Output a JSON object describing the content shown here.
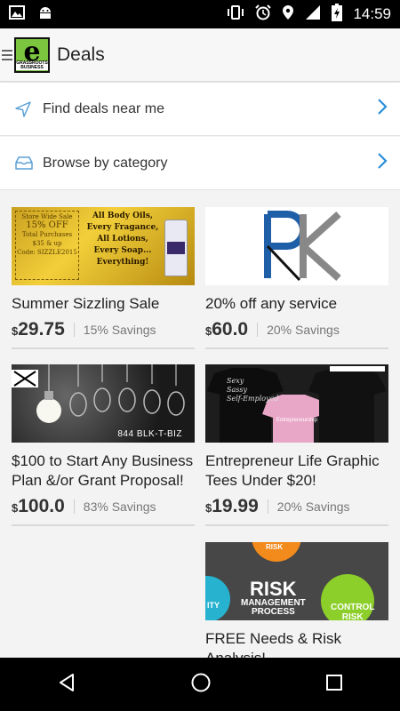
{
  "status": {
    "time": "14:59"
  },
  "header": {
    "title": "Deals",
    "logo_letter": "e",
    "logo_sub": "GRASSROOTS BUSINESS"
  },
  "rows": [
    {
      "label": "Find deals near me"
    },
    {
      "label": "Browse by category"
    }
  ],
  "deals": [
    {
      "title": "Summer Sizzling Sale",
      "currency": "$",
      "price": "29.75",
      "savings": "15% Savings",
      "image_text": [
        "All Body Oils,",
        "Every Fragance,",
        "All Lotions,",
        "Every Soap...",
        "Everything!"
      ],
      "image_coupon": [
        "Store Wide Sale",
        "15% OFF",
        "Total Purchases",
        "$35 & up",
        "Code: SIZZLE2015"
      ]
    },
    {
      "title": "20% off any service",
      "currency": "$",
      "price": "60.0",
      "savings": "20% Savings"
    },
    {
      "title": "$100 to Start Any Business Plan &/or Grant Proposal!",
      "currency": "$",
      "price": "100.0",
      "savings": "83% Savings",
      "image_text": [
        "844 BLK-T-BIZ"
      ]
    },
    {
      "title": "Entrepreneur Life Graphic Tees Under $20!",
      "currency": "$",
      "price": "19.99",
      "savings": "20% Savings",
      "image_text": [
        "Sexy",
        "Sassy",
        "Self-Employed",
        "Entrepreneurship"
      ]
    },
    {
      "title": "FREE Needs & Risk Analysis!",
      "image_text": [
        "RISK",
        "RISK",
        "MANAGEMENT",
        "PROCESS",
        "CONTROL",
        "RISK",
        "ITY"
      ]
    }
  ]
}
